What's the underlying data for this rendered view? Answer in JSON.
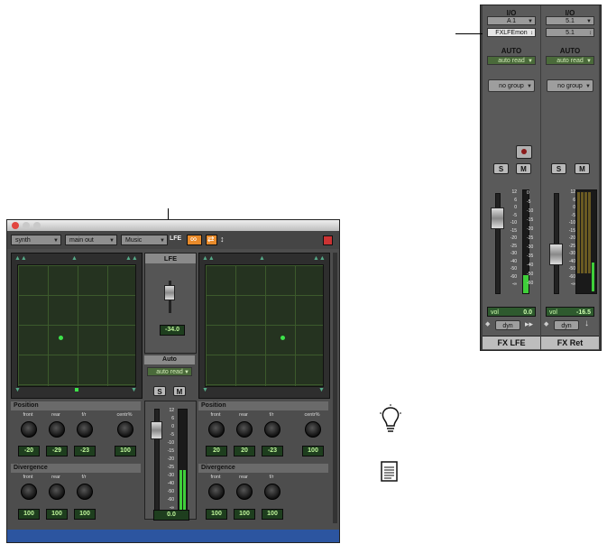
{
  "strips": [
    {
      "io_header": "I/O",
      "input": "A 1",
      "output": "FXLFEmon",
      "auto_header": "AUTO",
      "auto_mode": "auto read",
      "group": "no group",
      "solo": "S",
      "mute": "M",
      "vol_label": "vol",
      "vol_value": "0.0",
      "dyn": "dyn",
      "name": "FX LFE"
    },
    {
      "io_header": "I/O",
      "input": "5.1",
      "output": "5.1",
      "auto_header": "AUTO",
      "auto_mode": "auto read",
      "group": "no group",
      "solo": "S",
      "mute": "M",
      "vol_label": "vol",
      "vol_value": "-16.5",
      "dyn": "dyn",
      "name": "FX Ret"
    }
  ],
  "fader_scale": [
    "12",
    "6",
    "0",
    "-5",
    "-10",
    "-15",
    "-20",
    "-25",
    "-30",
    "-40",
    "-50",
    "-60",
    "-∞"
  ],
  "meter_scale": [
    "0",
    "-5",
    "-10",
    "-15",
    "-20",
    "-25",
    "-30",
    "-35",
    "-40",
    "-50",
    "-60"
  ],
  "panner": {
    "toolbar": {
      "track": "synth",
      "output": "main out",
      "insert": "Music",
      "lfe_button": "LFE"
    },
    "lfe": {
      "label": "LFE",
      "value": "-34.0"
    },
    "auto_label": "Auto",
    "auto_mode": "auto read",
    "solo": "S",
    "mute": "M",
    "center_value": "0.0",
    "left": {
      "position_title": "Position",
      "position_knobs": [
        {
          "label": "front",
          "value": "-20"
        },
        {
          "label": "rear",
          "value": "-29"
        },
        {
          "label": "f/r",
          "value": "-23"
        },
        {
          "label": "centr%",
          "value": "100"
        }
      ],
      "divergence_title": "Divergence",
      "divergence_knobs": [
        {
          "label": "front",
          "value": "100"
        },
        {
          "label": "rear",
          "value": "100"
        },
        {
          "label": "f/r",
          "value": "100"
        }
      ]
    },
    "right": {
      "position_title": "Position",
      "position_knobs": [
        {
          "label": "front",
          "value": "20"
        },
        {
          "label": "rear",
          "value": "20"
        },
        {
          "label": "f/r",
          "value": "-23"
        },
        {
          "label": "centr%",
          "value": "100"
        }
      ],
      "divergence_title": "Divergence",
      "divergence_knobs": [
        {
          "label": "front",
          "value": "100"
        },
        {
          "label": "rear",
          "value": "100"
        },
        {
          "label": "f/r",
          "value": "100"
        }
      ]
    }
  },
  "icons": {
    "tip": "lightbulb-icon",
    "reference": "document-icon"
  },
  "colors": {
    "meter_green": "#3fcf3a",
    "lcd_green": "#bff59a",
    "panel_dark": "#4d4d4d"
  }
}
